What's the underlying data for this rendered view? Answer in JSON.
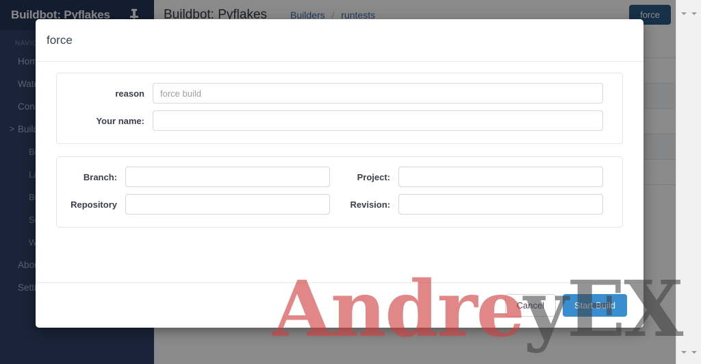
{
  "colors": {
    "sidebar_bg": "#30426a",
    "sidebar_header_bg": "#263659",
    "accent_primary": "#3a8ed0",
    "force_button_bg": "#2a5b86",
    "breadcrumb_link": "#3a6ea8",
    "watermark_red": "#ce3e3e",
    "watermark_grey": "#3c3c3c"
  },
  "sidebar": {
    "title": "Buildbot: Pyflakes",
    "pin_icon": "pin-icon",
    "section_label": "NAVIGATION",
    "items": [
      {
        "label": "Home",
        "sub": false,
        "caret": ""
      },
      {
        "label": "Waterfall View",
        "sub": false,
        "caret": ""
      },
      {
        "label": "Console View",
        "sub": false,
        "caret": ""
      },
      {
        "label": "Builds",
        "sub": false,
        "caret": ">"
      },
      {
        "label": "Builders",
        "sub": true,
        "caret": ""
      },
      {
        "label": "Last Builds",
        "sub": true,
        "caret": ""
      },
      {
        "label": "Buildrequests",
        "sub": true,
        "caret": ""
      },
      {
        "label": "Schedulers",
        "sub": true,
        "caret": ""
      },
      {
        "label": "Workers",
        "sub": true,
        "caret": ""
      },
      {
        "label": "About",
        "sub": false,
        "caret": ""
      },
      {
        "label": "Settings",
        "sub": false,
        "caret": ""
      }
    ]
  },
  "header": {
    "title": "Buildbot: Pyflakes",
    "breadcrumb": {
      "parent": "Builders",
      "separator": "/",
      "current": "runtests"
    },
    "force_button_label": "force"
  },
  "modal": {
    "title": "force",
    "fieldsets": [
      {
        "name": "reason-fieldset",
        "layout": "single",
        "rows": [
          {
            "label": "reason",
            "value": "",
            "placeholder": "force build",
            "name": "reason"
          },
          {
            "label": "Your name:",
            "value": "",
            "placeholder": "",
            "name": "username"
          }
        ]
      },
      {
        "name": "source-fieldset",
        "layout": "double",
        "rows": [
          [
            {
              "label": "Branch:",
              "value": "",
              "placeholder": "",
              "name": "branch"
            },
            {
              "label": "Project:",
              "value": "",
              "placeholder": "",
              "name": "project"
            }
          ],
          [
            {
              "label": "Repository",
              "value": "",
              "placeholder": "",
              "name": "repository"
            },
            {
              "label": "Revision:",
              "value": "",
              "placeholder": "",
              "name": "revision"
            }
          ]
        ]
      }
    ],
    "footer": {
      "cancel_label": "Cancel",
      "submit_label": "Start Build"
    }
  },
  "watermark": {
    "part_red": "Andre",
    "part_grey": "yEX"
  },
  "scrollbar": {
    "arrow_glyph": "down-arrow-icon"
  }
}
